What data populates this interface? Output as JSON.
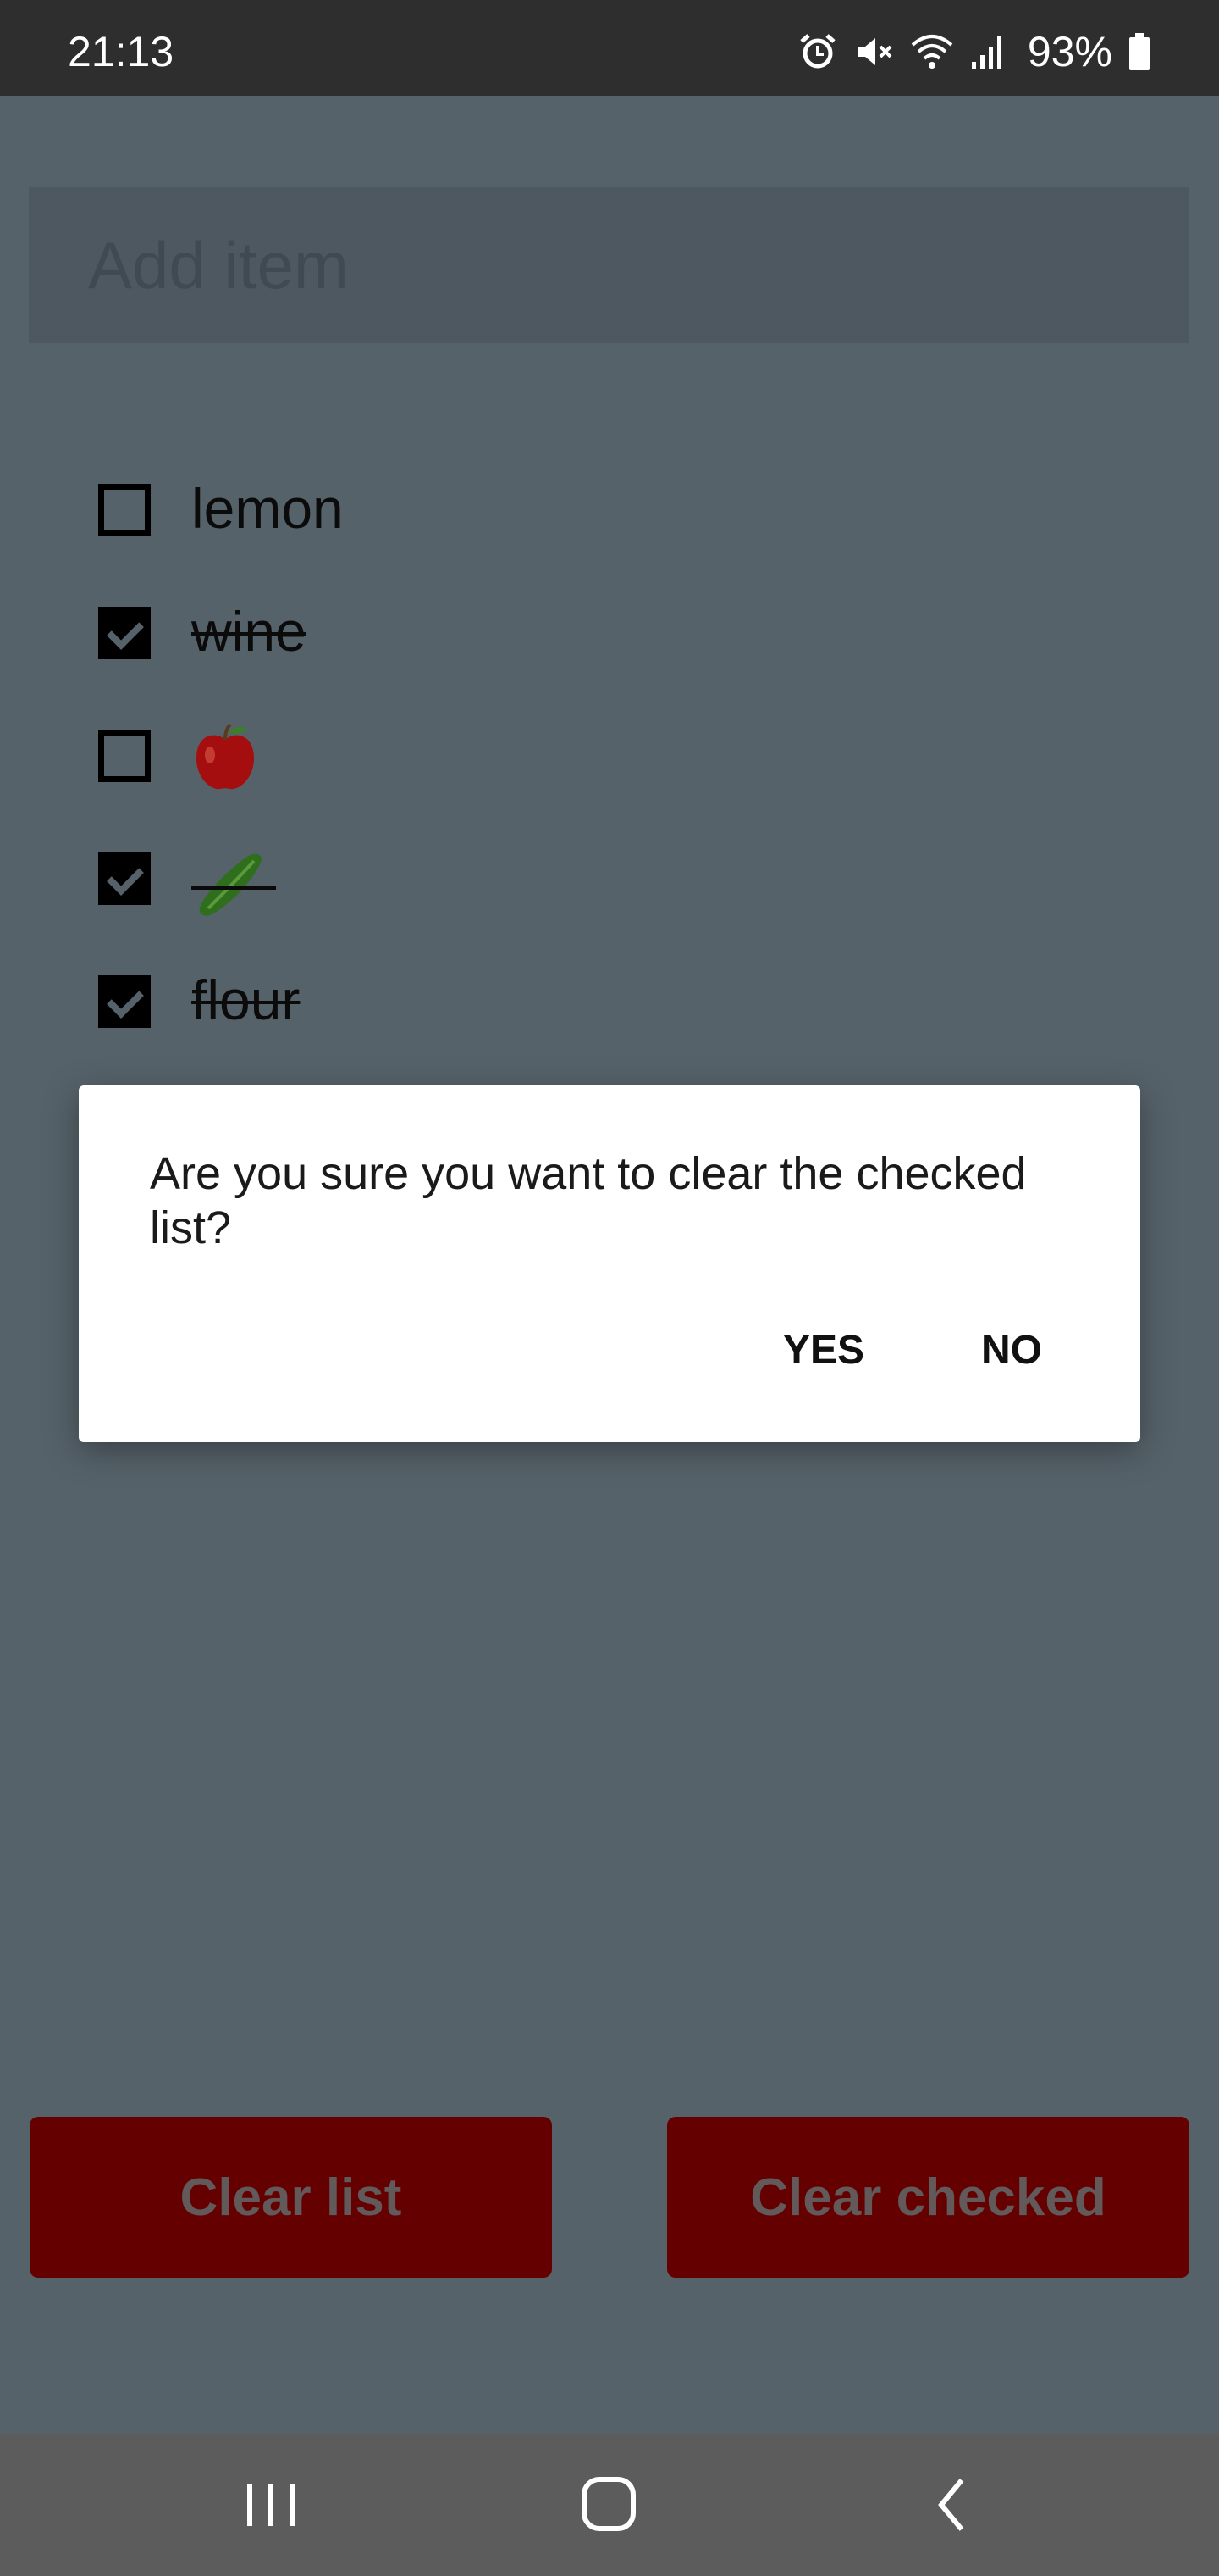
{
  "status_bar": {
    "time": "21:13",
    "battery": "93%",
    "icons": [
      "alarm-icon",
      "mute-icon",
      "wifi-icon",
      "signal-icon",
      "battery-icon"
    ]
  },
  "add_item": {
    "placeholder": "Add item"
  },
  "items": [
    {
      "label": "lemon",
      "checked": false
    },
    {
      "label": "wine",
      "checked": true
    },
    {
      "label": "🍎",
      "checked": false,
      "icon": "apple-emoji-icon"
    },
    {
      "label": "🥒",
      "checked": true,
      "icon": "cucumber-emoji-icon"
    },
    {
      "label": "flour",
      "checked": true
    }
  ],
  "dialog": {
    "message": "Are you sure you want to clear the checked list?",
    "yes": "YES",
    "no": "NO"
  },
  "buttons": {
    "clear_list": "Clear list",
    "clear_checked": "Clear checked"
  },
  "colors": {
    "button_bg": "#650000",
    "scrim_bg": "#56626a"
  },
  "navbar": {
    "icons": [
      "recents-icon",
      "home-icon",
      "back-icon"
    ]
  }
}
